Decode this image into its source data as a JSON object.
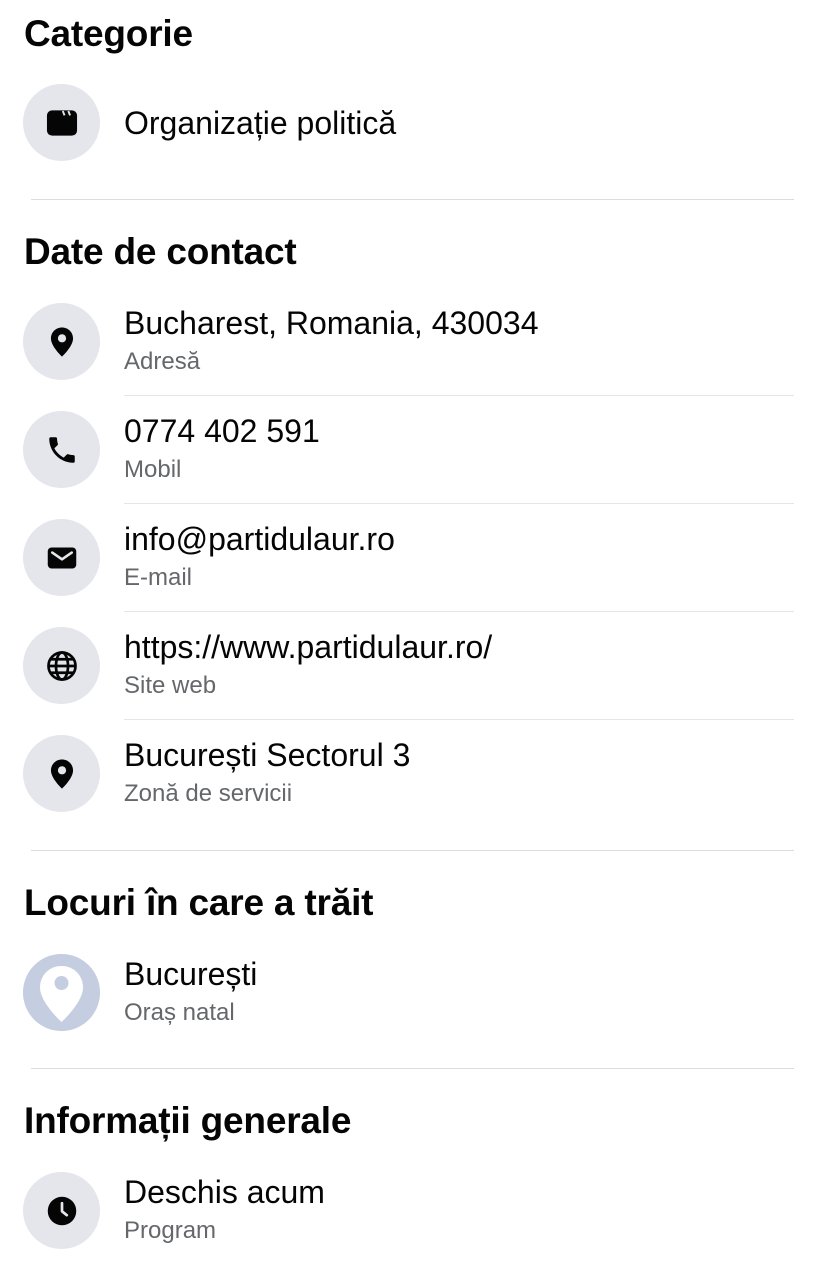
{
  "category": {
    "title": "Categorie",
    "value": "Organizație politică",
    "icon": "category-icon"
  },
  "contact": {
    "title": "Date de contact",
    "items": [
      {
        "value": "Bucharest, Romania, 430034",
        "label": "Adresă",
        "icon": "location-pin-icon"
      },
      {
        "value": "0774 402 591",
        "label": "Mobil",
        "icon": "phone-icon"
      },
      {
        "value": "info@partidulaur.ro",
        "label": "E-mail",
        "icon": "envelope-icon"
      },
      {
        "value": "https://www.partidulaur.ro/",
        "label": "Site web",
        "icon": "globe-icon"
      },
      {
        "value": "București Sectorul 3",
        "label": "Zonă de servicii",
        "icon": "location-pin-icon"
      }
    ]
  },
  "places": {
    "title": "Locuri în care a trăit",
    "items": [
      {
        "value": "București",
        "label": "Oraș natal",
        "icon": "place-thumbnail-icon"
      }
    ]
  },
  "general": {
    "title": "Informații generale",
    "items": [
      {
        "value": "Deschis acum",
        "label": "Program",
        "icon": "clock-icon"
      }
    ]
  },
  "colors": {
    "text_primary": "#050505",
    "text_secondary": "#65676b",
    "icon_bg": "#e4e6eb",
    "divider": "#dadde1"
  }
}
